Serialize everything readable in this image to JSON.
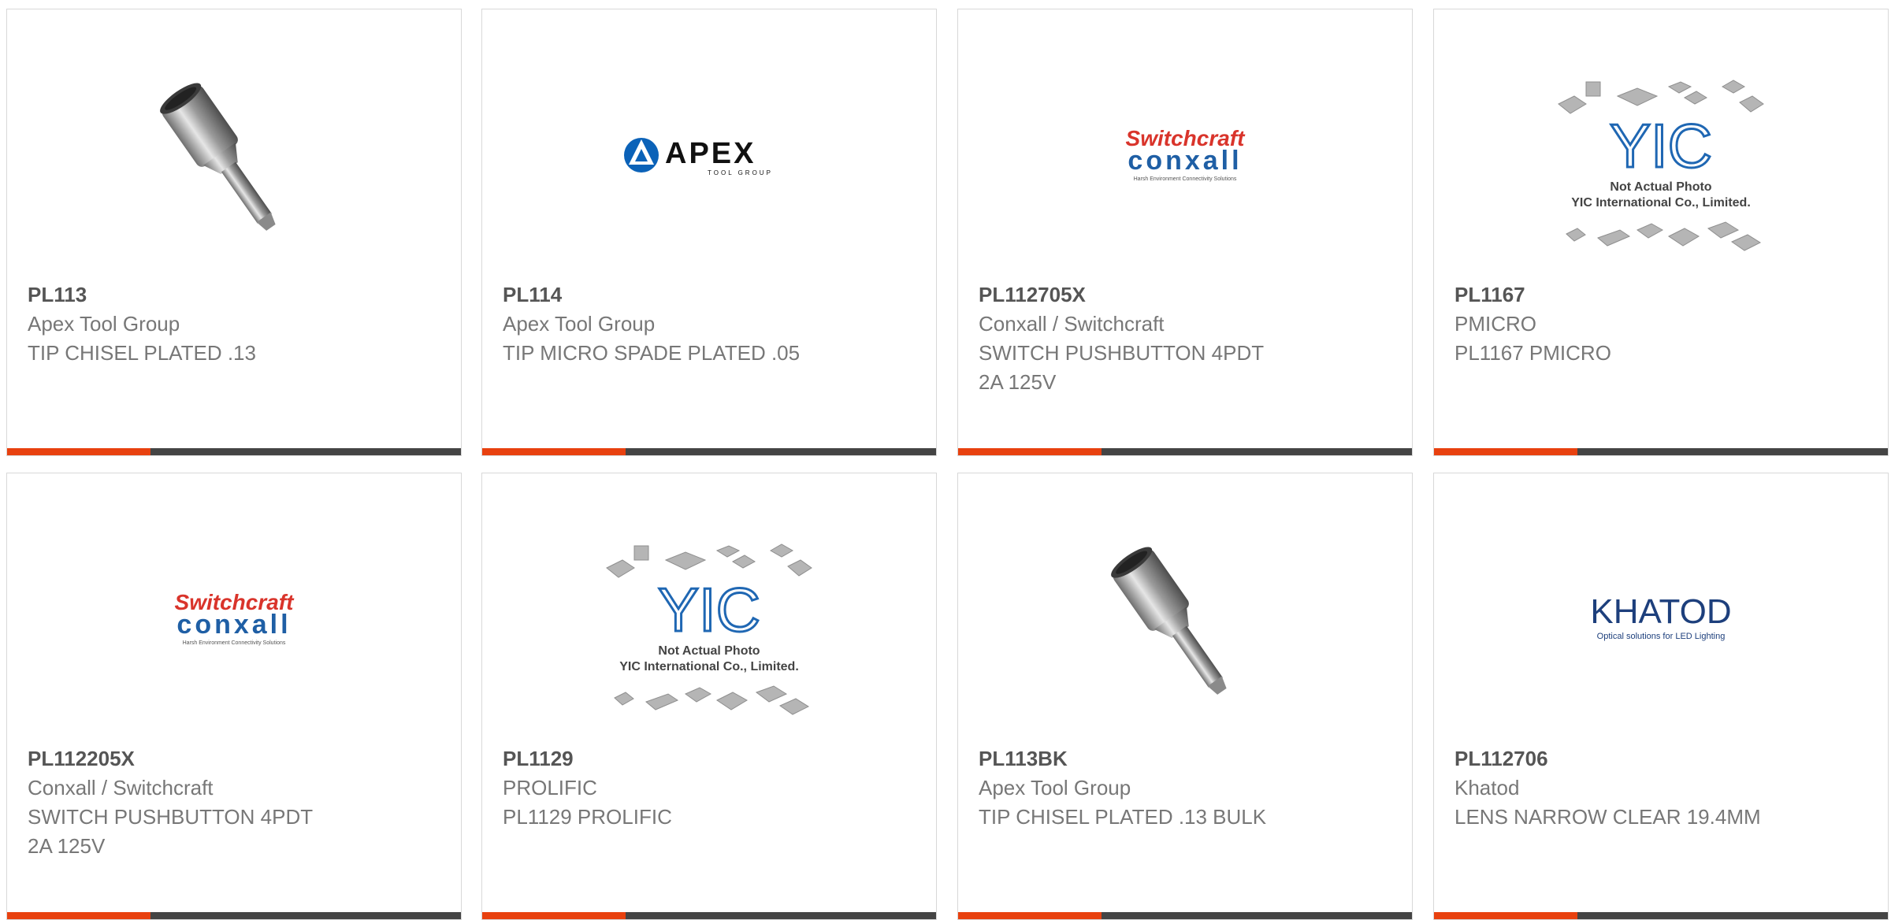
{
  "colors": {
    "accent_bar": "#e8410f",
    "dark_bar": "#444444",
    "part_number_text": "#555555",
    "body_text": "#777777"
  },
  "products": [
    {
      "part_number": "PL113",
      "manufacturer": "Apex Tool Group",
      "description": "TIP CHISEL PLATED .13",
      "image": "soldering-tip-photo"
    },
    {
      "part_number": "PL114",
      "manufacturer": "Apex Tool Group",
      "description": "TIP MICRO SPADE PLATED .05",
      "image": "apex-tool-group-logo",
      "logo_text": "APEX",
      "logo_subtext": "TOOL GROUP"
    },
    {
      "part_number": "PL112705X",
      "manufacturer": "Conxall / Switchcraft",
      "description": "SWITCH PUSHBUTTON 4PDT\n2A 125V",
      "image": "switchcraft-conxall-logo",
      "logo_text_top": "Switchcraft",
      "logo_text_bottom": "conxall",
      "logo_tagline": "Harsh Environment Connectivity Solutions"
    },
    {
      "part_number": "PL1167",
      "manufacturer": "PMICRO",
      "description": "PL1167 PMICRO",
      "image": "yic-placeholder",
      "logo_text": "YIC",
      "placeholder_line1": "Not Actual Photo",
      "placeholder_line2": "YIC International Co., Limited."
    },
    {
      "part_number": "PL112205X",
      "manufacturer": "Conxall / Switchcraft",
      "description": "SWITCH PUSHBUTTON 4PDT\n2A 125V",
      "image": "switchcraft-conxall-logo",
      "logo_text_top": "Switchcraft",
      "logo_text_bottom": "conxall",
      "logo_tagline": "Harsh Environment Connectivity Solutions"
    },
    {
      "part_number": "PL1129",
      "manufacturer": "PROLIFIC",
      "description": "PL1129 PROLIFIC",
      "image": "yic-placeholder",
      "logo_text": "YIC",
      "placeholder_line1": "Not Actual Photo",
      "placeholder_line2": "YIC International Co., Limited."
    },
    {
      "part_number": "PL113BK",
      "manufacturer": "Apex Tool Group",
      "description": "TIP CHISEL PLATED .13 BULK",
      "image": "soldering-tip-photo"
    },
    {
      "part_number": "PL112706",
      "manufacturer": "Khatod",
      "description": "LENS NARROW CLEAR 19.4MM",
      "image": "khatod-logo",
      "logo_text": "KHATOD",
      "logo_tagline": "Optical solutions for LED Lighting"
    }
  ]
}
